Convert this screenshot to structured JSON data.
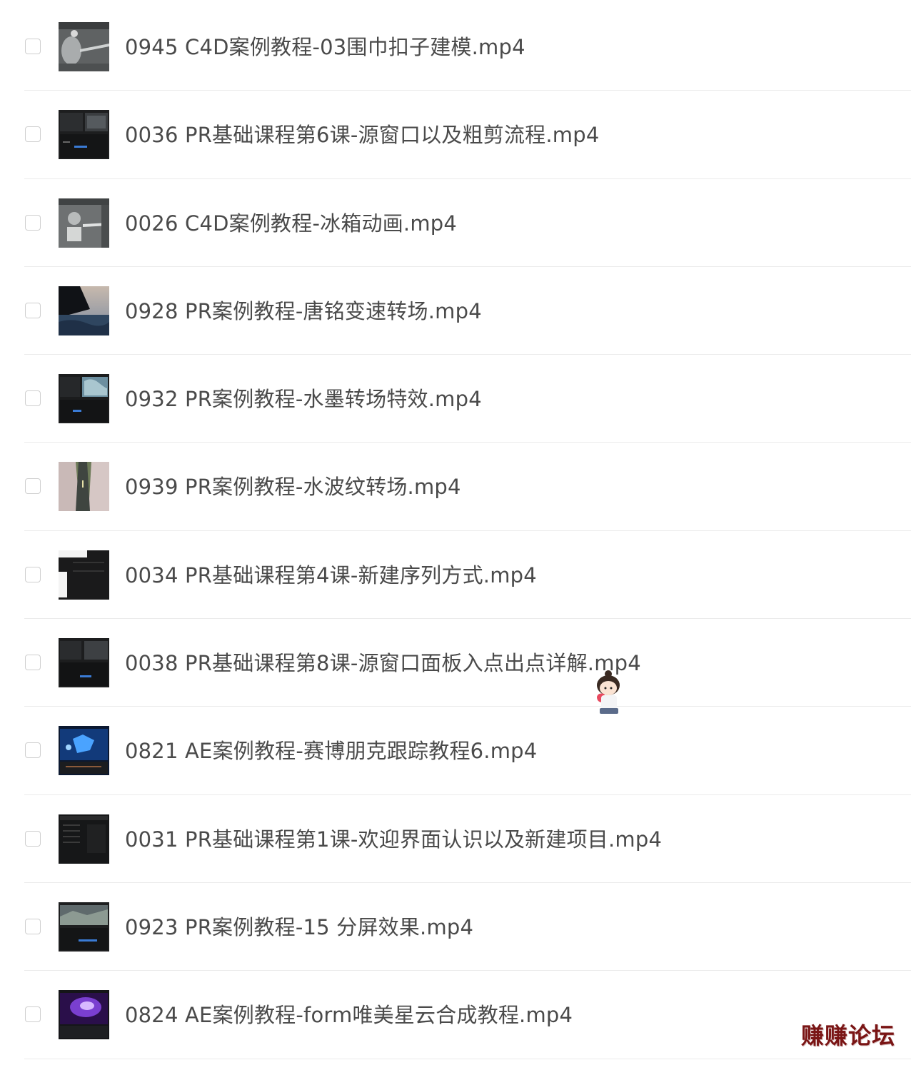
{
  "files": [
    {
      "name": "0945 C4D案例教程-03围巾扣子建模.mp4",
      "thumb_icon": "c4d-viewport-thumbnail"
    },
    {
      "name": "0036 PR基础课程第6课-源窗口以及粗剪流程.mp4",
      "thumb_icon": "premiere-ui-thumbnail"
    },
    {
      "name": "0026 C4D案例教程-冰箱动画.mp4",
      "thumb_icon": "c4d-viewport-thumbnail"
    },
    {
      "name": "0928 PR案例教程-唐铭变速转场.mp4",
      "thumb_icon": "ocean-scene-thumbnail"
    },
    {
      "name": "0932 PR案例教程-水墨转场特效.mp4",
      "thumb_icon": "premiere-ui-thumbnail"
    },
    {
      "name": "0939 PR案例教程-水波纹转场.mp4",
      "thumb_icon": "road-scene-thumbnail"
    },
    {
      "name": "0034 PR基础课程第4课-新建序列方式.mp4",
      "thumb_icon": "premiere-dark-thumbnail"
    },
    {
      "name": "0038 PR基础课程第8课-源窗口面板入点出点详解.mp4",
      "thumb_icon": "premiere-ui-thumbnail"
    },
    {
      "name": "0821 AE案例教程-赛博朋克跟踪教程6.mp4",
      "thumb_icon": "cyberpunk-blue-thumbnail"
    },
    {
      "name": "0031 PR基础课程第1课-欢迎界面认识以及新建项目.mp4",
      "thumb_icon": "premiere-dark-thumbnail"
    },
    {
      "name": "0923 PR案例教程-15 分屏效果.mp4",
      "thumb_icon": "premiere-ui-thumbnail"
    },
    {
      "name": "0824 AE案例教程-form唯美星云合成教程.mp4",
      "thumb_icon": "nebula-purple-thumbnail"
    }
  ],
  "watermark": "赚赚论坛",
  "colors": {
    "text": "#4a4a4a",
    "divider": "#ebebeb",
    "checkbox_border": "#cfcfcf",
    "watermark": "#7a1515"
  }
}
